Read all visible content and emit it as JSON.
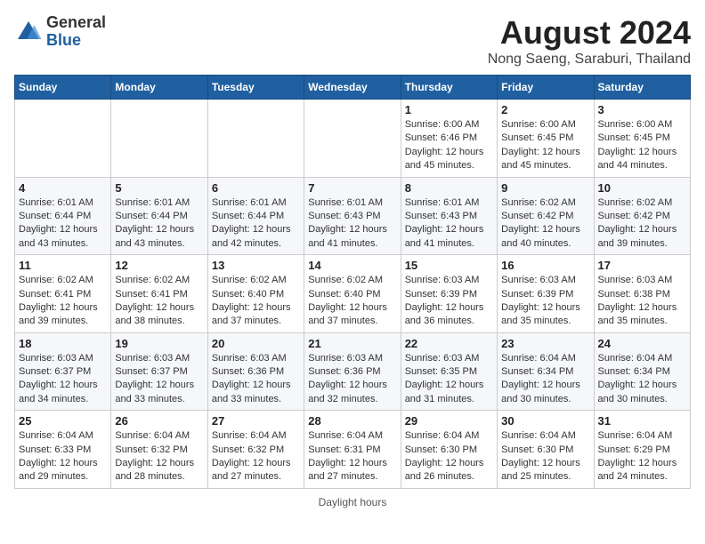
{
  "header": {
    "logo": {
      "line1": "General",
      "line2": "Blue"
    },
    "title": "August 2024",
    "location": "Nong Saeng, Saraburi, Thailand"
  },
  "calendar": {
    "weekdays": [
      "Sunday",
      "Monday",
      "Tuesday",
      "Wednesday",
      "Thursday",
      "Friday",
      "Saturday"
    ],
    "weeks": [
      [
        {
          "day": "",
          "info": ""
        },
        {
          "day": "",
          "info": ""
        },
        {
          "day": "",
          "info": ""
        },
        {
          "day": "",
          "info": ""
        },
        {
          "day": "1",
          "info": "Sunrise: 6:00 AM\nSunset: 6:46 PM\nDaylight: 12 hours\nand 45 minutes."
        },
        {
          "day": "2",
          "info": "Sunrise: 6:00 AM\nSunset: 6:45 PM\nDaylight: 12 hours\nand 45 minutes."
        },
        {
          "day": "3",
          "info": "Sunrise: 6:00 AM\nSunset: 6:45 PM\nDaylight: 12 hours\nand 44 minutes."
        }
      ],
      [
        {
          "day": "4",
          "info": "Sunrise: 6:01 AM\nSunset: 6:44 PM\nDaylight: 12 hours\nand 43 minutes."
        },
        {
          "day": "5",
          "info": "Sunrise: 6:01 AM\nSunset: 6:44 PM\nDaylight: 12 hours\nand 43 minutes."
        },
        {
          "day": "6",
          "info": "Sunrise: 6:01 AM\nSunset: 6:44 PM\nDaylight: 12 hours\nand 42 minutes."
        },
        {
          "day": "7",
          "info": "Sunrise: 6:01 AM\nSunset: 6:43 PM\nDaylight: 12 hours\nand 41 minutes."
        },
        {
          "day": "8",
          "info": "Sunrise: 6:01 AM\nSunset: 6:43 PM\nDaylight: 12 hours\nand 41 minutes."
        },
        {
          "day": "9",
          "info": "Sunrise: 6:02 AM\nSunset: 6:42 PM\nDaylight: 12 hours\nand 40 minutes."
        },
        {
          "day": "10",
          "info": "Sunrise: 6:02 AM\nSunset: 6:42 PM\nDaylight: 12 hours\nand 39 minutes."
        }
      ],
      [
        {
          "day": "11",
          "info": "Sunrise: 6:02 AM\nSunset: 6:41 PM\nDaylight: 12 hours\nand 39 minutes."
        },
        {
          "day": "12",
          "info": "Sunrise: 6:02 AM\nSunset: 6:41 PM\nDaylight: 12 hours\nand 38 minutes."
        },
        {
          "day": "13",
          "info": "Sunrise: 6:02 AM\nSunset: 6:40 PM\nDaylight: 12 hours\nand 37 minutes."
        },
        {
          "day": "14",
          "info": "Sunrise: 6:02 AM\nSunset: 6:40 PM\nDaylight: 12 hours\nand 37 minutes."
        },
        {
          "day": "15",
          "info": "Sunrise: 6:03 AM\nSunset: 6:39 PM\nDaylight: 12 hours\nand 36 minutes."
        },
        {
          "day": "16",
          "info": "Sunrise: 6:03 AM\nSunset: 6:39 PM\nDaylight: 12 hours\nand 35 minutes."
        },
        {
          "day": "17",
          "info": "Sunrise: 6:03 AM\nSunset: 6:38 PM\nDaylight: 12 hours\nand 35 minutes."
        }
      ],
      [
        {
          "day": "18",
          "info": "Sunrise: 6:03 AM\nSunset: 6:37 PM\nDaylight: 12 hours\nand 34 minutes."
        },
        {
          "day": "19",
          "info": "Sunrise: 6:03 AM\nSunset: 6:37 PM\nDaylight: 12 hours\nand 33 minutes."
        },
        {
          "day": "20",
          "info": "Sunrise: 6:03 AM\nSunset: 6:36 PM\nDaylight: 12 hours\nand 33 minutes."
        },
        {
          "day": "21",
          "info": "Sunrise: 6:03 AM\nSunset: 6:36 PM\nDaylight: 12 hours\nand 32 minutes."
        },
        {
          "day": "22",
          "info": "Sunrise: 6:03 AM\nSunset: 6:35 PM\nDaylight: 12 hours\nand 31 minutes."
        },
        {
          "day": "23",
          "info": "Sunrise: 6:04 AM\nSunset: 6:34 PM\nDaylight: 12 hours\nand 30 minutes."
        },
        {
          "day": "24",
          "info": "Sunrise: 6:04 AM\nSunset: 6:34 PM\nDaylight: 12 hours\nand 30 minutes."
        }
      ],
      [
        {
          "day": "25",
          "info": "Sunrise: 6:04 AM\nSunset: 6:33 PM\nDaylight: 12 hours\nand 29 minutes."
        },
        {
          "day": "26",
          "info": "Sunrise: 6:04 AM\nSunset: 6:32 PM\nDaylight: 12 hours\nand 28 minutes."
        },
        {
          "day": "27",
          "info": "Sunrise: 6:04 AM\nSunset: 6:32 PM\nDaylight: 12 hours\nand 27 minutes."
        },
        {
          "day": "28",
          "info": "Sunrise: 6:04 AM\nSunset: 6:31 PM\nDaylight: 12 hours\nand 27 minutes."
        },
        {
          "day": "29",
          "info": "Sunrise: 6:04 AM\nSunset: 6:30 PM\nDaylight: 12 hours\nand 26 minutes."
        },
        {
          "day": "30",
          "info": "Sunrise: 6:04 AM\nSunset: 6:30 PM\nDaylight: 12 hours\nand 25 minutes."
        },
        {
          "day": "31",
          "info": "Sunrise: 6:04 AM\nSunset: 6:29 PM\nDaylight: 12 hours\nand 24 minutes."
        }
      ]
    ]
  },
  "footer": {
    "note": "Daylight hours"
  }
}
